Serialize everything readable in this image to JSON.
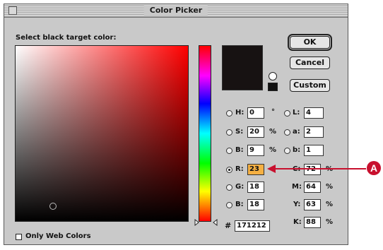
{
  "window": {
    "title": "Color Picker"
  },
  "prompt": "Select black target color:",
  "buttons": {
    "ok": "OK",
    "cancel": "Cancel",
    "custom": "Custom"
  },
  "hsb": {
    "h": {
      "label": "H:",
      "value": "0",
      "unit": "°"
    },
    "s": {
      "label": "S:",
      "value": "20",
      "unit": "%"
    },
    "b": {
      "label": "B:",
      "value": "9",
      "unit": "%"
    }
  },
  "lab": {
    "l": {
      "label": "L:",
      "value": "4"
    },
    "a": {
      "label": "a:",
      "value": "2"
    },
    "b": {
      "label": "b:",
      "value": "1"
    }
  },
  "rgb": {
    "r": {
      "label": "R:",
      "value": "23"
    },
    "g": {
      "label": "G:",
      "value": "18"
    },
    "b": {
      "label": "B:",
      "value": "18"
    }
  },
  "cmyk": {
    "c": {
      "label": "C:",
      "value": "72",
      "unit": "%"
    },
    "m": {
      "label": "M:",
      "value": "64",
      "unit": "%"
    },
    "y": {
      "label": "Y:",
      "value": "63",
      "unit": "%"
    },
    "k": {
      "label": "K:",
      "value": "88",
      "unit": "%"
    }
  },
  "hex": {
    "label": "#",
    "value": "171212"
  },
  "only_web_colors": {
    "label": "Only Web Colors",
    "checked": false
  },
  "callout": {
    "letter": "A",
    "color": "#c8102e"
  },
  "current_color": "#171212"
}
